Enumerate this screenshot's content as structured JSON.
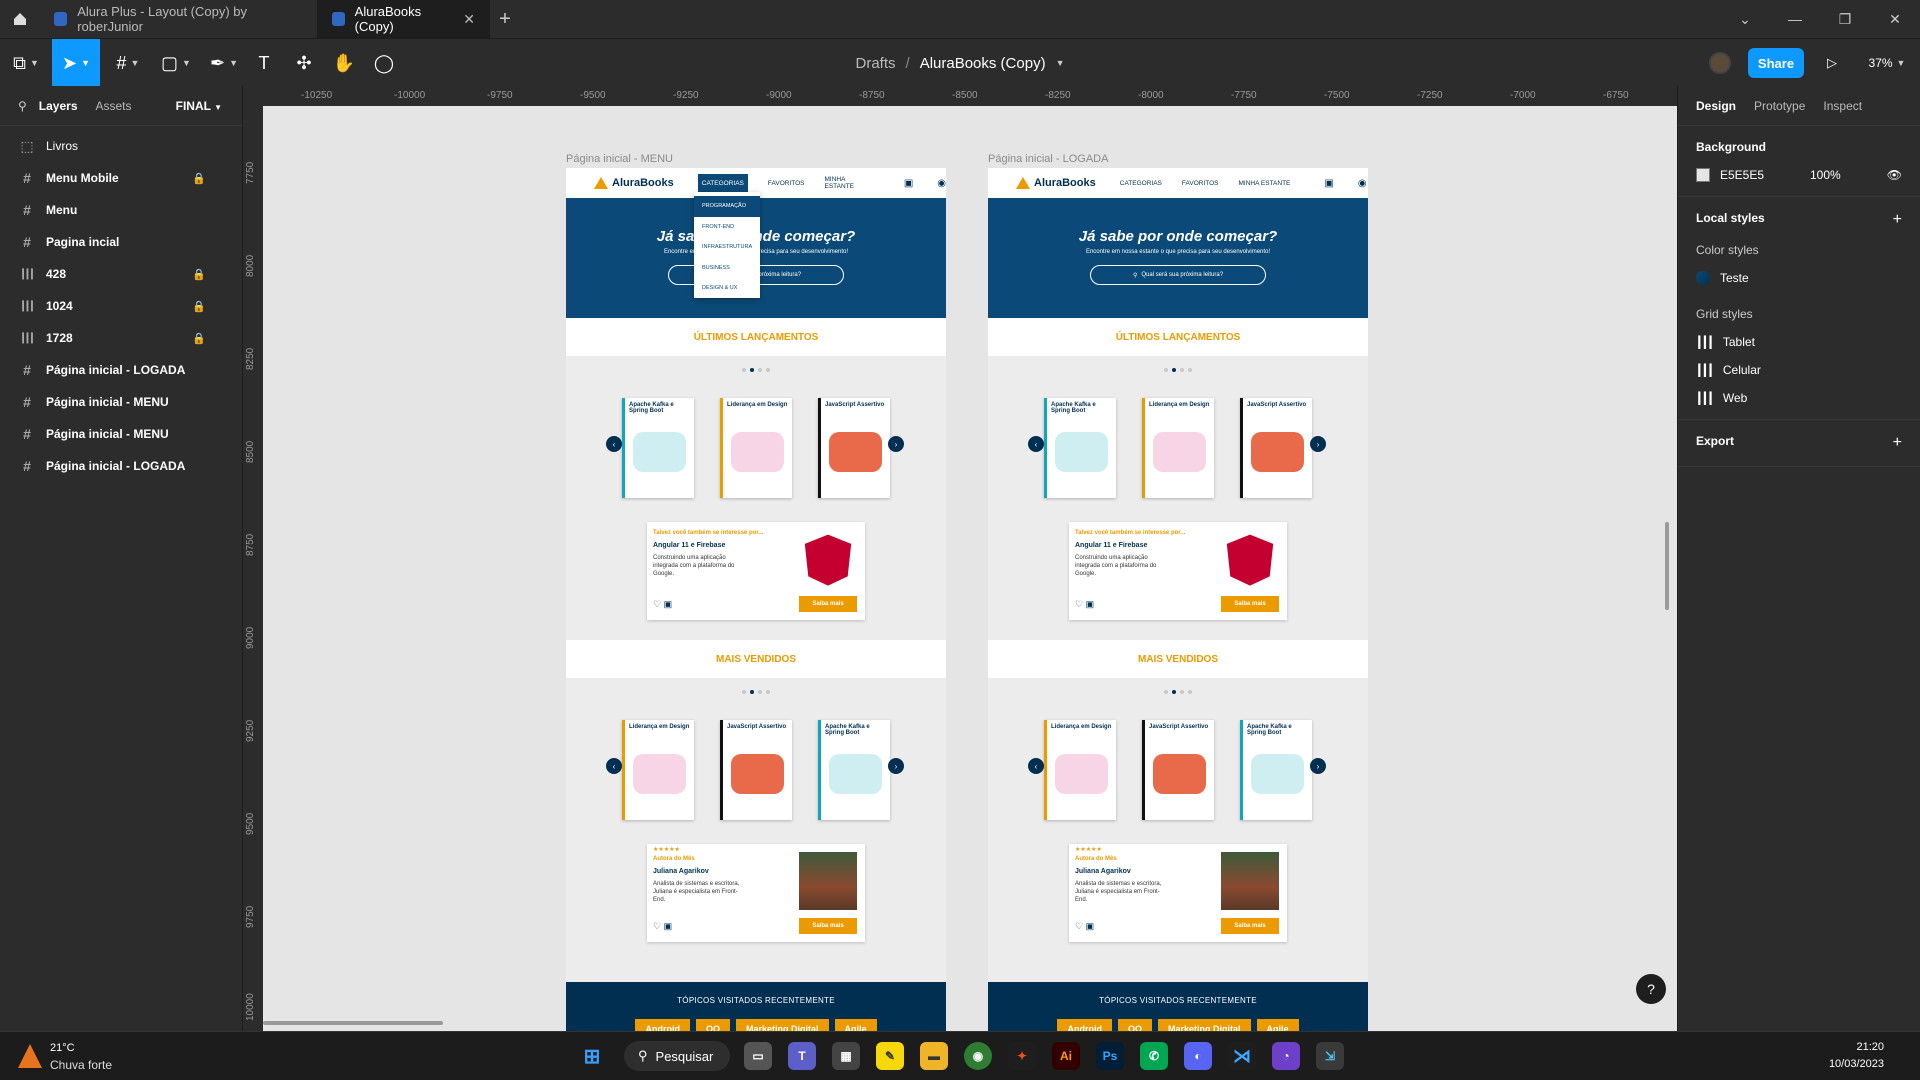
{
  "tabs": [
    {
      "label": "Alura Plus - Layout (Copy) by roberJunior"
    },
    {
      "label": "AluraBooks (Copy)"
    }
  ],
  "toolbar": {
    "drafts": "Drafts",
    "separator": "/",
    "file": "AluraBooks (Copy)",
    "share": "Share",
    "zoom": "37%"
  },
  "left": {
    "tabs": {
      "layers": "Layers",
      "assets": "Assets",
      "page": "FINAL"
    },
    "layers": [
      {
        "icon": "dashed-frame-icon",
        "label": "Livros",
        "locked": false,
        "bold": false
      },
      {
        "icon": "frame-icon",
        "label": "Menu Mobile",
        "locked": true,
        "bold": true
      },
      {
        "icon": "frame-icon",
        "label": "Menu",
        "locked": false,
        "bold": true
      },
      {
        "icon": "frame-icon",
        "label": "Pagina incial",
        "locked": false,
        "bold": true
      },
      {
        "icon": "grid-icon",
        "label": "428",
        "locked": true,
        "bold": true
      },
      {
        "icon": "grid-icon",
        "label": "1024",
        "locked": true,
        "bold": true
      },
      {
        "icon": "grid-icon",
        "label": "1728",
        "locked": true,
        "bold": true
      },
      {
        "icon": "frame-icon",
        "label": "Página inicial - LOGADA",
        "locked": false,
        "bold": true
      },
      {
        "icon": "frame-icon",
        "label": "Página inicial - MENU",
        "locked": false,
        "bold": true
      },
      {
        "icon": "frame-icon",
        "label": "Página inicial - MENU",
        "locked": false,
        "bold": true
      },
      {
        "icon": "frame-icon",
        "label": "Página inicial - LOGADA",
        "locked": false,
        "bold": true
      }
    ]
  },
  "ruler": {
    "top": [
      "-10250",
      "-10000",
      "-9750",
      "-9500",
      "-9250",
      "-9000",
      "-8750",
      "-8500",
      "-8250",
      "-8000",
      "-7750",
      "-7500",
      "-7250",
      "-7000",
      "-6750"
    ],
    "left": [
      "7750",
      "8000",
      "8250",
      "8500",
      "8750",
      "9000",
      "9250",
      "9500",
      "9750",
      "10000"
    ]
  },
  "right": {
    "tabs": {
      "design": "Design",
      "prototype": "Prototype",
      "inspect": "Inspect"
    },
    "background": {
      "title": "Background",
      "hex": "E5E5E5",
      "opacity": "100%",
      "color": "#e5e5e5"
    },
    "local_styles": "Local styles",
    "color_styles": "Color styles",
    "color_style_name": "Teste",
    "grid_styles": "Grid styles",
    "grids": [
      "Tablet",
      "Celular",
      "Web"
    ],
    "export": "Export"
  },
  "frames": [
    {
      "label": "Página inicial - MENU",
      "nav": {
        "logo": "AluraBooks",
        "links": [
          "CATEGORIAS",
          "FAVORITOS",
          "MINHA ESTANTE"
        ]
      },
      "hero": {
        "title": "Já sabe por onde começar?",
        "subtitle": "Encontre em nossa estante o que precisa para seu desenvolvimento!",
        "search": "Qual será sua próxima leitura?"
      },
      "dropdown": [
        "PROGRAMAÇÃO",
        "FRONT-END",
        "INFRAESTRUTURA",
        "BUSINESS",
        "DESIGN & UX"
      ]
    },
    {
      "label": "Página inicial - LOGADA",
      "nav": {
        "logo": "AluraBooks",
        "links": [
          "CATEGORIAS",
          "FAVORITOS",
          "MINHA ESTANTE"
        ]
      },
      "hero": {
        "title": "Já sabe por onde começar?",
        "subtitle": "Encontre em nossa estante o que precisa para seu desenvolvimento!",
        "search": "Qual será sua próxima leitura?"
      }
    }
  ],
  "design": {
    "launches": "ÚLTIMOS LANÇAMENTOS",
    "best": "MAIS VENDIDOS",
    "books1": [
      "Apache Kafka e Spring Boot",
      "Liderança em Design",
      "JavaScript Assertivo"
    ],
    "books2": [
      "Liderança em Design",
      "JavaScript Assertivo",
      "Apache Kafka e Spring Boot"
    ],
    "card1": {
      "kicker": "Talvez você também se interesse por...",
      "title": "Angular 11 e Firebase",
      "desc": "Construindo uma aplicação integrada com a plataforma do Google.",
      "btn": "Saiba mais"
    },
    "card2": {
      "stars": "★★★★★",
      "kicker": "Autora do Mês",
      "title": "Juliana Agarikov",
      "desc": "Analista de sistemas e escritora, Juliana é especialista em Front-End.",
      "btn": "Saiba mais"
    },
    "recent": "TÓPICOS VISITADOS RECENTEMENTE",
    "tags": [
      "Android",
      "OO",
      "Marketing Digital",
      "Agile"
    ]
  },
  "taskbar": {
    "weather_temp": "21°C",
    "weather_desc": "Chuva forte",
    "search": "Pesquisar",
    "time": "21:20",
    "date": "10/03/2023"
  },
  "colors": {
    "accent": "#0d99ff",
    "brand_orange": "#eb9b00",
    "brand_navy": "#002f52"
  }
}
